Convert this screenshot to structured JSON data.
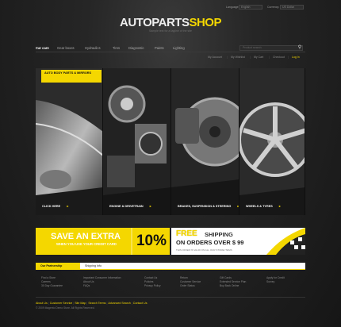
{
  "header": {
    "language_label": "Language:",
    "language_value": "English",
    "currency_label": "Currency:",
    "currency_value": "US Dollar",
    "logo_part1": "AUTOPARTS",
    "logo_part2": "SHOP",
    "tagline": "Sample text for a tagline of the site"
  },
  "nav": {
    "items": [
      "Car care",
      "Gear boxes",
      "Hydraulics",
      "Tires",
      "Diagnostic",
      "Paints",
      "Lighting"
    ],
    "search_placeholder": "Product search",
    "search_icon": "search-icon"
  },
  "account": {
    "links": [
      "My Account",
      "My Wishlist",
      "My Cart",
      "Checkout",
      "Log In"
    ]
  },
  "panels": [
    {
      "label": "CLICK HERE",
      "header": "AUTO BODY PARTS & MIRRORS"
    },
    {
      "label": "ENGINE & DRIVETRAIN"
    },
    {
      "label": "BRAKES, SUSPENSION & STEERING"
    },
    {
      "label": "WHEELS & TYRES"
    }
  ],
  "banners": {
    "left_line1": "SAVE AN EXTRA",
    "left_line2": "WHEN YOU USE YOUR CREDIT CARD",
    "left_pct": "10%",
    "right_line1": "FREE",
    "right_line1b": "SHIPPING",
    "right_line2": "ON ORDERS OVER $ 99",
    "right_line3": "THIS OFFER IS VALID ON ALL OUR STORE ITEMS"
  },
  "tabs": {
    "active": "Our Partnership",
    "inactive": "Shipping Info"
  },
  "footer_columns": [
    [
      "Find a Store",
      "Careers",
      "30 Day Guarantee"
    ],
    [
      "Important Consumer Information",
      "About Us",
      "FAQs"
    ],
    [
      "Contact Us",
      "Policies",
      "Privacy Policy"
    ],
    [
      "Return",
      "Customer Service",
      "Order Status"
    ],
    [
      "Gift Cards",
      "Extended Service Plan",
      "Buy Back Online"
    ],
    [
      "Apply for Credit",
      "Survey"
    ]
  ],
  "footer_nav": [
    "About Us",
    "Customer Service",
    "Site Map",
    "Search Terms",
    "Advanced Search",
    "Contact Us"
  ],
  "copyright": "© 2009 Magento Demo Store. All Rights Reserved.",
  "colors": {
    "accent": "#f4d700",
    "background": "#1b1b1b"
  }
}
